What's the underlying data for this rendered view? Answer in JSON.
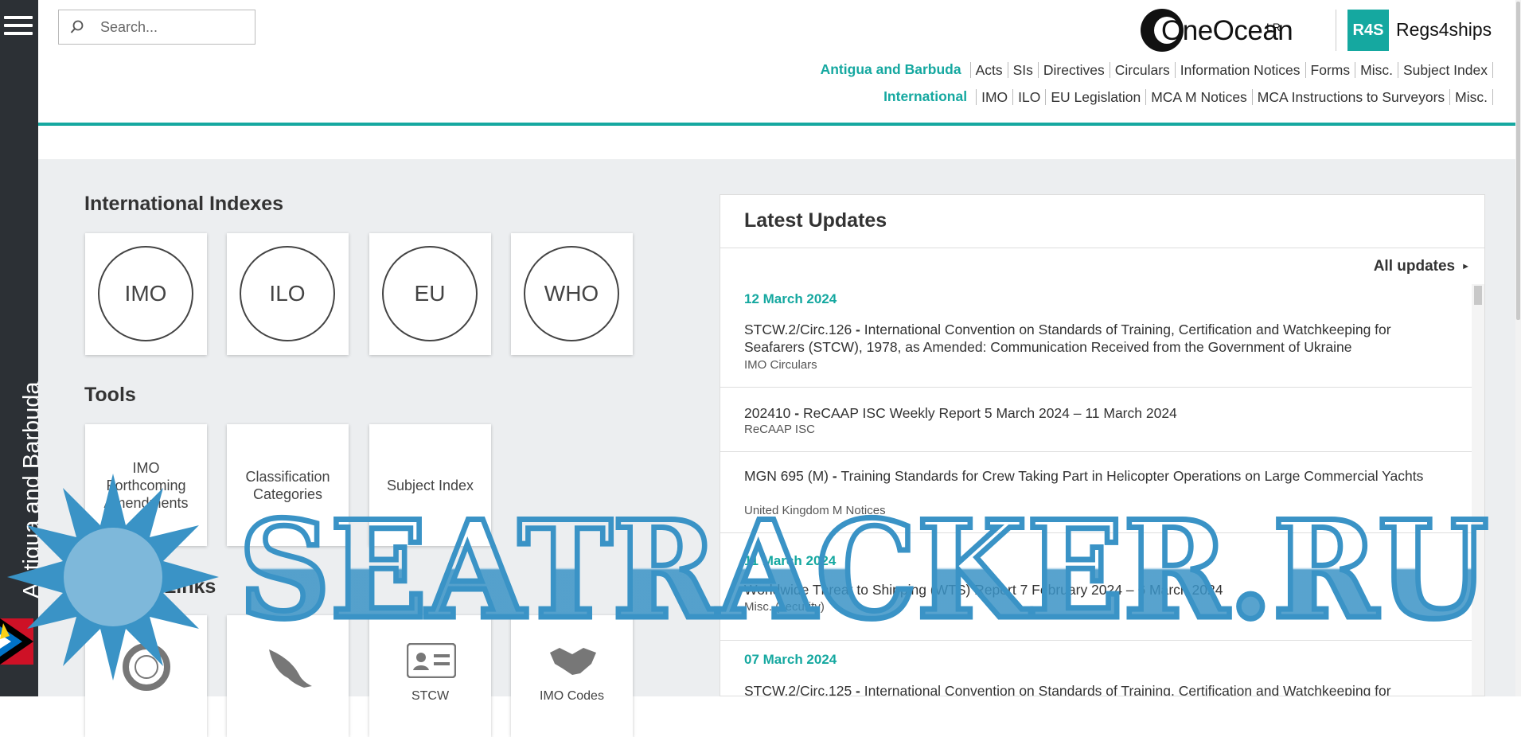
{
  "rail": {
    "country": "Antigua and Barbuda"
  },
  "search": {
    "placeholder": "Search..."
  },
  "brand": {
    "oneocean_text": "OneOcean",
    "oneocean_sup": "LR",
    "r4s_badge": "R4S",
    "r4s_name": "Regs4ships"
  },
  "nav": {
    "row1_label": "Antigua and Barbuda",
    "row1_items": [
      "Acts",
      "SIs",
      "Directives",
      "Circulars",
      "Information Notices",
      "Forms",
      "Misc.",
      "Subject Index"
    ],
    "row2_label": "International",
    "row2_items": [
      "IMO",
      "ILO",
      "EU Legislation",
      "MCA M Notices",
      "MCA Instructions to Surveyors",
      "Misc."
    ]
  },
  "indexes": {
    "title": "International Indexes",
    "items": [
      "IMO",
      "ILO",
      "EU",
      "WHO"
    ]
  },
  "tools": {
    "title": "Tools",
    "items": [
      "IMO Forthcoming Amendments",
      "Classification Categories",
      "Subject Index"
    ]
  },
  "popular": {
    "title": "Popular Links",
    "items": [
      "",
      "",
      "STCW",
      "IMO Codes"
    ]
  },
  "updates": {
    "title": "Latest Updates",
    "all_link": "All updates",
    "groups": [
      {
        "date": "12 March 2024",
        "items": [
          {
            "ref": "STCW.2/Circ.126",
            "text": "International Convention on Standards of Training, Certification and Watchkeeping for Seafarers (STCW), 1978, as Amended: Communication Received from the Government of Ukraine",
            "source": "IMO Circulars"
          },
          {
            "ref": "202410",
            "text": "ReCAAP ISC Weekly Report 5 March 2024 – 11 March 2024",
            "source": "ReCAAP ISC"
          },
          {
            "ref": "MGN 695 (M)",
            "text": "Training Standards for Crew Taking Part in Helicopter Operations on Large Commercial Yachts",
            "source": "United Kingdom M Notices"
          }
        ]
      },
      {
        "date": "11 March 2024",
        "items": [
          {
            "ref": "",
            "text": "Worldwide Threat to Shipping (WTS) Report 7 February 2024 – 6 March 2024",
            "source": "Misc. (security)"
          }
        ]
      },
      {
        "date": "07 March 2024",
        "items": [
          {
            "ref": "STCW.2/Circ.125",
            "text": "International Convention on Standards of Training, Certification and Watchkeeping for",
            "source": ""
          }
        ]
      }
    ]
  },
  "watermark": {
    "text": "SEATRACKER.RU"
  },
  "colors": {
    "accent": "#15a8a0",
    "rail": "#2c3035",
    "watermark": "#3a93c6"
  }
}
